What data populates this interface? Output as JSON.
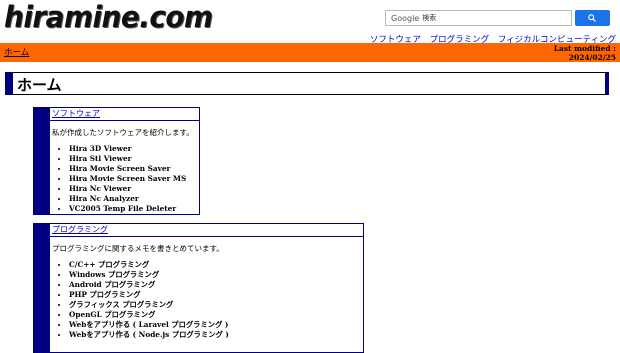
{
  "header": {
    "logo": "hiramine.com",
    "search": {
      "brand": "Google",
      "placeholder": "検索"
    },
    "nav": [
      "ソフトウェア",
      "プログラミング",
      "フィジカルコンピューティング"
    ]
  },
  "bar": {
    "home_link": "ホーム",
    "last_modified_label": "Last modified :",
    "last_modified_date": "2024/02/25"
  },
  "page": {
    "title": "ホーム"
  },
  "sections": [
    {
      "heading": "ソフトウェア",
      "description": "私が作成したソフトウェアを紹介します。",
      "items": [
        "Hira 3D Viewer",
        "Hira Stl Viewer",
        "Hira Movie Screen Saver",
        "Hira Movie Screen Saver MS",
        "Hira Nc Viewer",
        "Hira Nc Analyzer",
        "VC2005 Temp File Deleter"
      ]
    },
    {
      "heading": "プログラミング",
      "description": "プログラミングに関するメモを書きとめています。",
      "items": [
        "C/C++ プログラミング",
        "Windows プログラミング",
        "Android プログラミング",
        "PHP プログラミング",
        "グラフィックス プログラミング",
        "OpenGL プログラミング",
        "Webをアプリ作る ( Laravel プログラミング )",
        "Webをアプリ作る ( Node.js プログラミング )"
      ]
    }
  ],
  "colors": {
    "accent_bar": "#ff6600",
    "frame": "#000080",
    "link": "#0000cc",
    "search_button": "#1a73e8"
  }
}
